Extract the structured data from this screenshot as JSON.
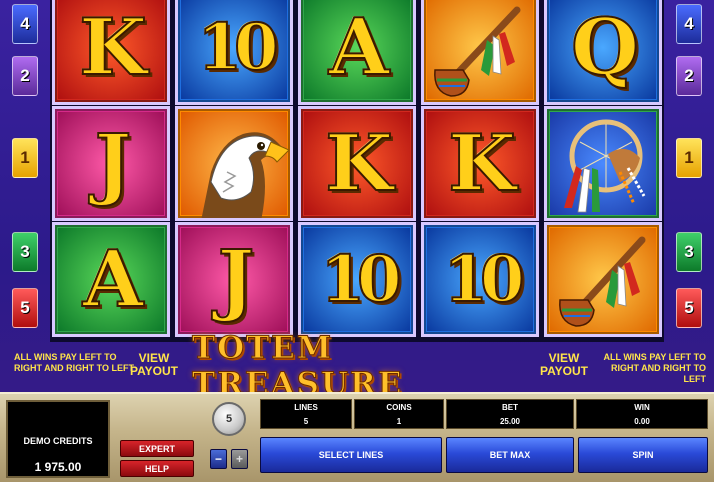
{
  "game": {
    "title": "TOTEM TREASURE",
    "view_payout_left": "VIEW PAYOUT",
    "view_payout_right": "VIEW PAYOUT",
    "wins_note_left": "ALL WINS PAY LEFT TO RIGHT AND RIGHT TO LEFT",
    "wins_note_right": "ALL WINS PAY LEFT TO RIGHT AND RIGHT TO LEFT"
  },
  "reels": [
    [
      "K",
      "J",
      "A"
    ],
    [
      "10",
      "eagle",
      "J"
    ],
    [
      "A",
      "K",
      "10"
    ],
    [
      "pipe",
      "K",
      "10"
    ],
    [
      "Q",
      "dreamcatcher",
      "pipe"
    ]
  ],
  "symbol_colors": {
    "red": "#d2281e",
    "orange": "#ff8a00",
    "green": "#2fa84a",
    "blue": "#1f6fe0",
    "magenta": "#d62a8a",
    "gold": "#ffcf1a"
  },
  "line_badges_left": [
    "4",
    "2",
    "1",
    "3",
    "5"
  ],
  "line_badges_right": [
    "4",
    "2",
    "1",
    "3",
    "5"
  ],
  "panel": {
    "credits_label": "DEMO CREDITS",
    "credits_value": "1 975.00",
    "expert_label": "EXPERT",
    "help_label": "HELP",
    "coin_value": "5",
    "minus_label": "−",
    "plus_label": "+",
    "lines_header": "LINES",
    "lines_value": "5",
    "coins_header": "COINS",
    "coins_value": "1",
    "bet_header": "BET",
    "bet_value": "25.00",
    "win_header": "WIN",
    "win_value": "0.00",
    "select_lines_label": "SELECT LINES",
    "bet_max_label": "BET MAX",
    "spin_label": "SPIN"
  }
}
